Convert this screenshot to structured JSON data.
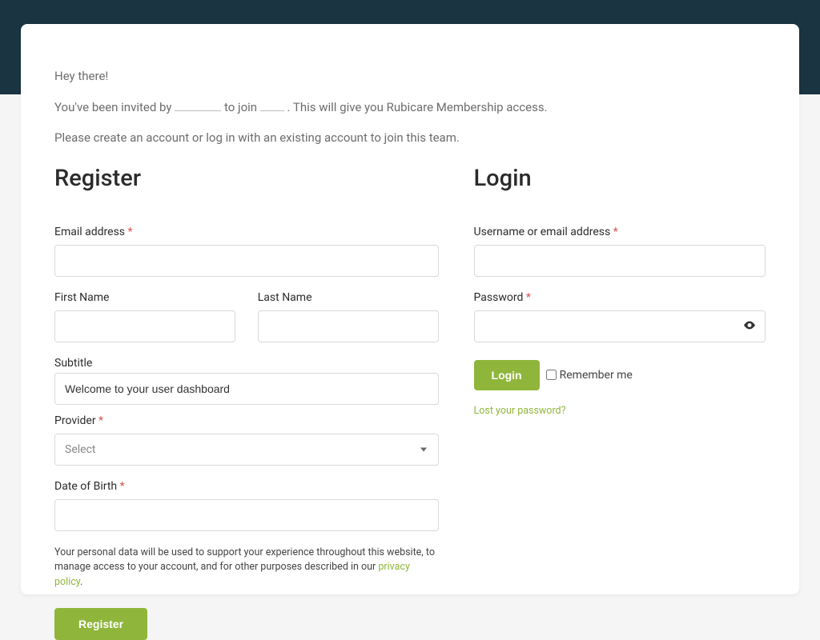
{
  "intro": {
    "greeting": "Hey there!",
    "invited_pre": "You've been invited by ",
    "invited_mid": " to join ",
    "invited_post": " . This will give you Rubicare Membership access.",
    "instruction": "Please create an account or log in with an existing account to join this team."
  },
  "register": {
    "heading": "Register",
    "email_label": "Email address ",
    "first_name_label": "First Name",
    "last_name_label": "Last Name",
    "subtitle_label": "Subtitle",
    "subtitle_value": "Welcome to your user dashboard",
    "provider_label": "Provider ",
    "provider_placeholder": "Select",
    "dob_label": "Date of Birth ",
    "privacy_text_pre": "Your personal data will be used to support your experience throughout this website, to manage access to your account, and for other purposes described in our ",
    "privacy_link_text": "privacy policy",
    "privacy_text_post": ".",
    "button": "Register"
  },
  "login": {
    "heading": "Login",
    "username_label": "Username or email address ",
    "password_label": "Password ",
    "button": "Login",
    "remember_label": "Remember me",
    "lost_password": "Lost your password?"
  },
  "required_marker": "*"
}
